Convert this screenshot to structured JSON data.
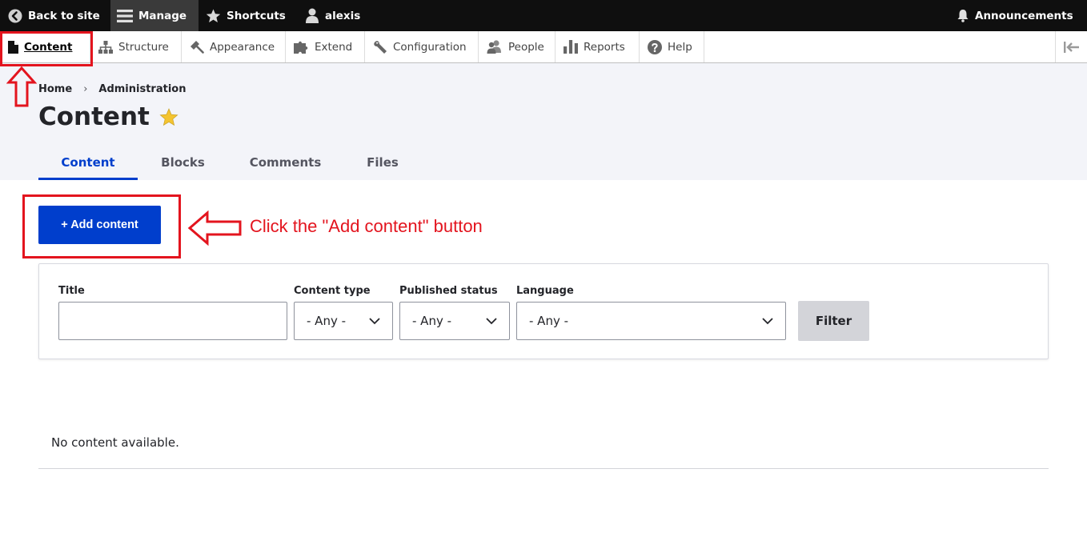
{
  "toolbar": {
    "back_to_site": "Back to site",
    "manage": "Manage",
    "shortcuts": "Shortcuts",
    "user": "alexis",
    "announcements": "Announcements"
  },
  "tray": {
    "items": [
      {
        "label": "Content",
        "icon": "file-icon",
        "active": true
      },
      {
        "label": "Structure",
        "icon": "sitemap-icon"
      },
      {
        "label": "Appearance",
        "icon": "paintbrush-icon"
      },
      {
        "label": "Extend",
        "icon": "puzzle-icon"
      },
      {
        "label": "Configuration",
        "icon": "wrench-icon"
      },
      {
        "label": "People",
        "icon": "people-icon"
      },
      {
        "label": "Reports",
        "icon": "bar-chart-icon"
      },
      {
        "label": "Help",
        "icon": "help-icon"
      }
    ]
  },
  "breadcrumb": [
    "Home",
    "Administration"
  ],
  "page_title": "Content",
  "tabs": [
    "Content",
    "Blocks",
    "Comments",
    "Files"
  ],
  "add_content_label": "+ Add content",
  "annotation": "Click the \"Add content\" button",
  "filter": {
    "title_label": "Title",
    "title_value": "",
    "content_type_label": "Content type",
    "content_type_value": "- Any -",
    "published_label": "Published status",
    "published_value": "- Any -",
    "language_label": "Language",
    "language_value": "- Any -",
    "button": "Filter"
  },
  "empty_message": "No content available.",
  "colors": {
    "accent": "#003ecc",
    "annotation": "#e3141e",
    "toolbar": "#0f0f0f"
  }
}
